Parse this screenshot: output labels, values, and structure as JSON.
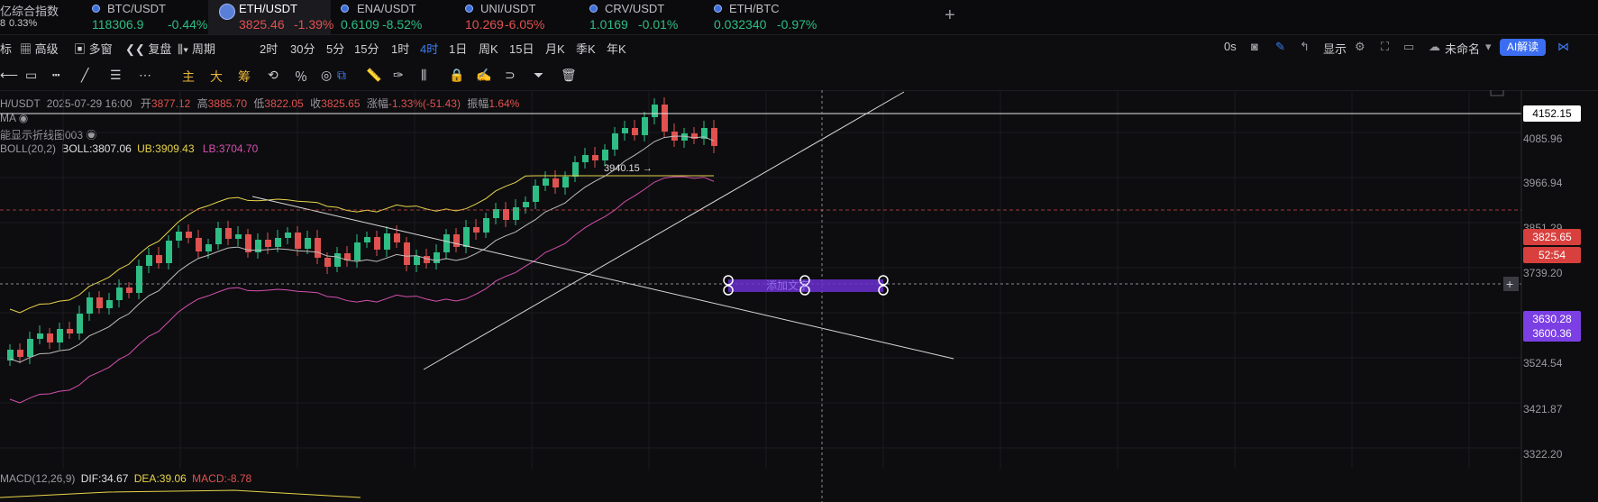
{
  "tickers": [
    {
      "name": "亿综合指数",
      "price": "8",
      "change": "0.33%",
      "color": "#c8c8cc"
    },
    {
      "name": "BTC/USDT",
      "price": "118306.9",
      "change": "-0.44%",
      "color": "#2ebd85"
    },
    {
      "name": "ETH/USDT",
      "price": "3825.46",
      "change": "-1.39%",
      "color": "#e0514f"
    },
    {
      "name": "ENA/USDT",
      "price": "0.6109",
      "change": "-8.52%",
      "color": "#2ebd85"
    },
    {
      "name": "UNI/USDT",
      "price": "10.269",
      "change": "-6.05%",
      "color": "#e0514f"
    },
    {
      "name": "CRV/USDT",
      "price": "1.0169",
      "change": "-0.01%",
      "color": "#2ebd85"
    },
    {
      "name": "ETH/BTC",
      "price": "0.032340",
      "change": "-0.97%",
      "color": "#2ebd85"
    }
  ],
  "add_tab": "+",
  "toolbar": {
    "left": [
      "标",
      "高级",
      "多窗",
      "复盘",
      "周期"
    ],
    "periods": [
      "2时",
      "30分",
      "5分",
      "15分",
      "1时",
      "4时",
      "1日",
      "周K",
      "15日",
      "月K",
      "季K",
      "年K"
    ],
    "active_period": "4时",
    "right": {
      "countdown": "0s",
      "display": "显示",
      "layout_name": "未命名",
      "ai": "AI解读"
    }
  },
  "drawing_tools": [
    "主",
    "大",
    "筹"
  ],
  "ohlc": {
    "symbol": "H/USDT",
    "date": "2025-07-29 16:00",
    "open_label": "开",
    "open": "3877.12",
    "high_label": "高",
    "high": "3885.70",
    "low_label": "低",
    "low": "3822.05",
    "close_label": "收",
    "close": "3825.65",
    "chg_label": "涨幅",
    "chg": "-1.33%(-51.43)",
    "amp_label": "振幅",
    "amp": "1.64%"
  },
  "indicators": {
    "ma": "MA",
    "custom": "能显示折线图003",
    "boll_name": "BOLL(20,2)",
    "boll": "BOLL:3807.06",
    "ub": "UB:3909.43",
    "lb": "LB:3704.70",
    "macd_name": "MACD(12,26,9)",
    "dif": "DIF:34.67",
    "dea": "DEA:39.06",
    "macd": "MACD:-8.78"
  },
  "y_axis": [
    "4085.96",
    "3966.94",
    "3851.29",
    "3739.20",
    "3524.54",
    "3421.87",
    "3322.20"
  ],
  "price_tags": {
    "line": "4152.15",
    "current": "3825.65",
    "countdown": "52:54",
    "purple_top": "3630.28",
    "purple_bottom": "3600.36"
  },
  "annotations": {
    "peak": "3940.15 →",
    "text_box": "添加文字"
  },
  "colors": {
    "up": "#2ebd85",
    "down": "#e0514f",
    "ub": "#e8d44a",
    "lb": "#d64fb0",
    "mid": "#c8c8c8",
    "accent": "#7b3fe4"
  }
}
